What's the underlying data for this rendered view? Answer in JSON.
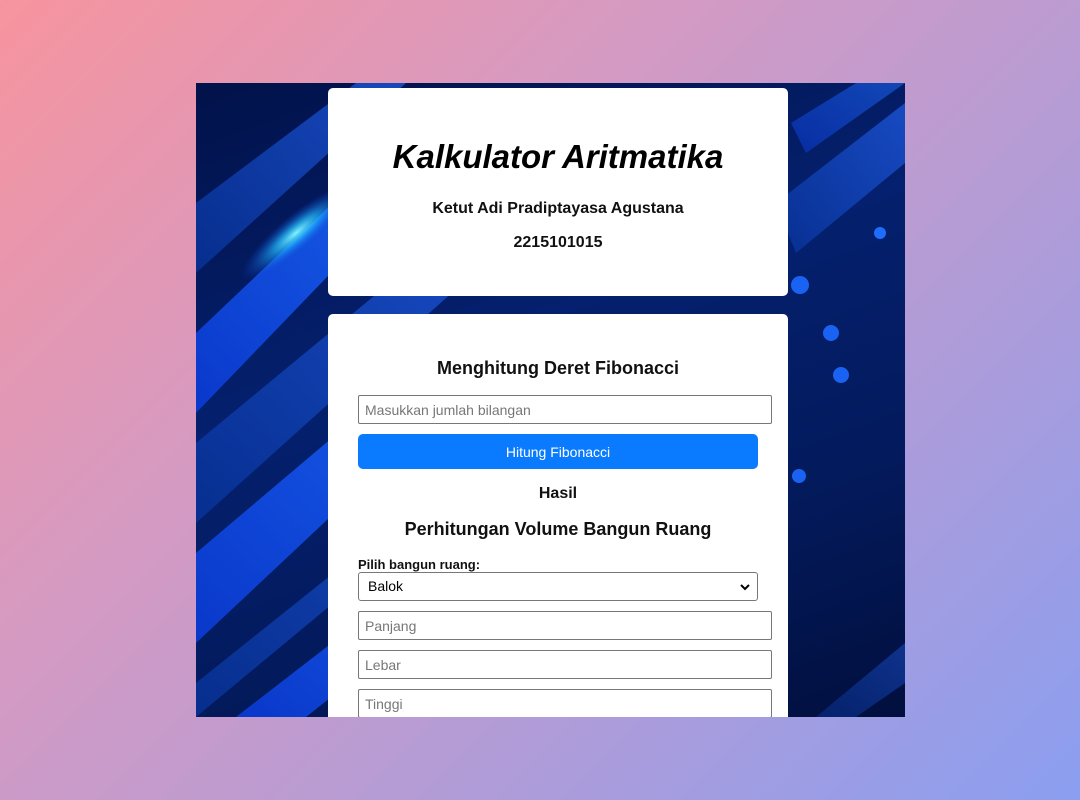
{
  "header": {
    "title": "Kalkulator Aritmatika",
    "author": "Ketut Adi Pradiptayasa Agustana",
    "student_id": "2215101015"
  },
  "fibonacci": {
    "title": "Menghitung Deret Fibonacci",
    "input_placeholder": "Masukkan jumlah bilangan",
    "button_label": "Hitung Fibonacci",
    "result_label": "Hasil"
  },
  "volume": {
    "title": "Perhitungan Volume Bangun Ruang",
    "select_label": "Pilih bangun ruang:",
    "selected_shape": "Balok",
    "fields": {
      "length_placeholder": "Panjang",
      "width_placeholder": "Lebar",
      "height_placeholder": "Tinggi"
    }
  },
  "colors": {
    "primary_button": "#0a7bff",
    "background_panel": "#04206e"
  },
  "icons": {
    "select_arrow": "chevron-down-icon"
  }
}
